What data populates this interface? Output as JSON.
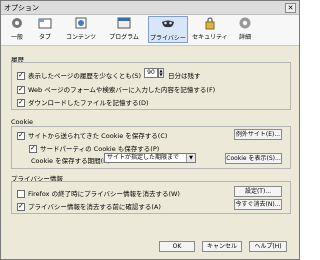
{
  "window": {
    "title": "オプション",
    "close_symbol": "✕"
  },
  "toolbar": [
    {
      "label": "一般",
      "icon": "gear-small-icon"
    },
    {
      "label": "タブ",
      "icon": "tabs-icon"
    },
    {
      "label": "コンテンツ",
      "icon": "content-icon"
    },
    {
      "label": "プログラム",
      "icon": "programs-icon"
    },
    {
      "label": "プライバシー",
      "icon": "privacy-mask-icon",
      "selected": true
    },
    {
      "label": "セキュリティ",
      "icon": "security-lock-icon"
    },
    {
      "label": "詳細",
      "icon": "advanced-gear-icon"
    }
  ],
  "history": {
    "section_title": "履歴",
    "remember_visited_label": "表示したページの履歴を少なくとも(S)",
    "days_value": "90",
    "days_suffix": "日分は残す",
    "remember_form_label": "Web ページのフォームや検索バーに入力した内容を記憶する(F)",
    "remember_downloads_label": "ダウンロードしたファイルを記憶する(D)"
  },
  "cookie": {
    "section_title": "Cookie",
    "accept_label": "サイトから送られてきた Cookie を保存する(C)",
    "exceptions_button": "例外サイト(E)...",
    "third_party_label": "サードパーティの Cookie も保存する(P)",
    "keep_until_label": "Cookie を保存する期間(K):",
    "keep_until_value": "サイトが指定した期限まで",
    "show_cookies_button": "Cookie を表示(S)..."
  },
  "private_data": {
    "section_title": "プライバシー情報",
    "clear_on_close_label": "Firefox の終了時にプライバシー情報を消去する(W)",
    "settings_button": "設定(T)...",
    "ask_before_label": "プライバシー情報を消去する前に確認する(A)",
    "clear_now_button": "今すぐ消去(N)..."
  },
  "footer": {
    "ok": "OK",
    "cancel": "キャンセル",
    "help": "ヘルプ(H)"
  },
  "colors": {
    "selected_tab": "#d7e6f9",
    "accent": "#7f9ecf"
  }
}
